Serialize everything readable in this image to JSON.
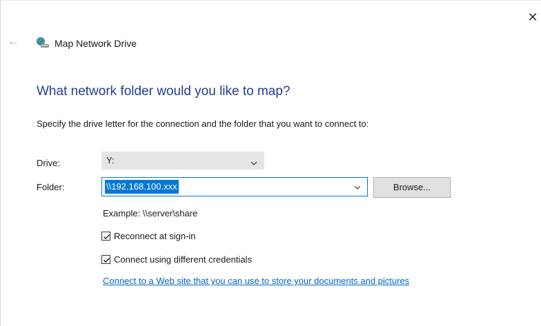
{
  "window": {
    "title": "Map Network Drive",
    "close_glyph": "✕",
    "back_glyph": "←"
  },
  "main": {
    "heading": "What network folder would you like to map?",
    "instruction": "Specify the drive letter for the connection and the folder that you want to connect to:",
    "drive_label": "Drive:",
    "drive_value": "Y:",
    "folder_label": "Folder:",
    "folder_value": "\\\\192.168.100.xxx",
    "browse_label": "Browse...",
    "example_text": "Example: \\\\server\\share",
    "reconnect_label": "Reconnect at sign-in",
    "reconnect_checked": true,
    "credentials_label": "Connect using different credentials",
    "credentials_checked": true,
    "web_link": "Connect to a Web site that you can use to store your documents and pictures"
  },
  "icons": {
    "title_icon": "network-drive-icon",
    "chevron": "chevron-down-icon",
    "check": "checkmark-icon"
  },
  "colors": {
    "accent": "#0078d7",
    "heading": "#213f8f",
    "link": "#0066cc"
  }
}
